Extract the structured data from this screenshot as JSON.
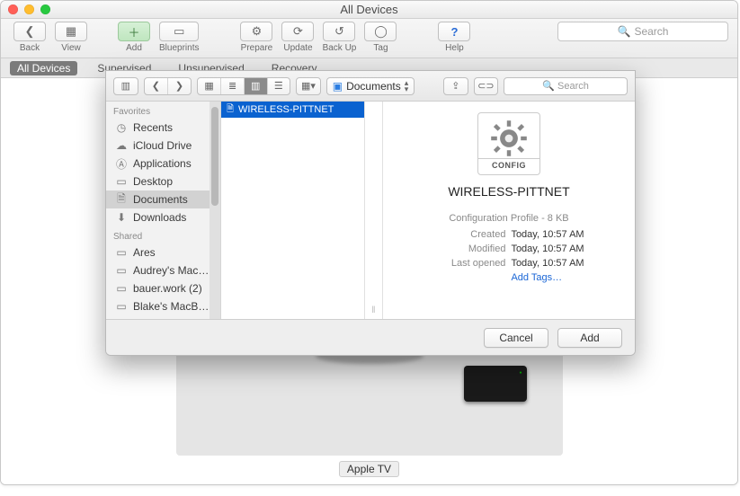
{
  "window": {
    "title": "All Devices"
  },
  "toolbar": {
    "back": "Back",
    "view": "View",
    "add": "Add",
    "blueprints": "Blueprints",
    "prepare": "Prepare",
    "update": "Update",
    "backup": "Back Up",
    "tag": "Tag",
    "help": "Help",
    "search_placeholder": "Search"
  },
  "scopes": {
    "all": "All Devices",
    "supervised": "Supervised",
    "unsupervised": "Unsupervised",
    "recovery": "Recovery"
  },
  "device_label": "Apple TV",
  "sheet": {
    "location": "Documents",
    "search_text": "Search",
    "sidebar": {
      "favorites_header": "Favorites",
      "items": [
        {
          "label": "Recents"
        },
        {
          "label": "iCloud Drive"
        },
        {
          "label": "Applications"
        },
        {
          "label": "Desktop"
        },
        {
          "label": "Documents"
        },
        {
          "label": "Downloads"
        }
      ],
      "shared_header": "Shared",
      "shared": [
        {
          "label": "Ares"
        },
        {
          "label": "Audrey's Mac…"
        },
        {
          "label": "bauer.work (2)"
        },
        {
          "label": "Blake's MacB…"
        }
      ]
    },
    "column": {
      "selected_file": "WIRELESS-PITTNET"
    },
    "preview": {
      "config_word": "CONFIG",
      "title": "WIRELESS-PITTNET",
      "subtitle": "Configuration Profile - 8 KB",
      "rows": {
        "created_k": "Created",
        "created_v": "Today, 10:57 AM",
        "modified_k": "Modified",
        "modified_v": "Today, 10:57 AM",
        "opened_k": "Last opened",
        "opened_v": "Today, 10:57 AM"
      },
      "add_tags": "Add Tags…"
    },
    "buttons": {
      "cancel": "Cancel",
      "add": "Add"
    }
  }
}
